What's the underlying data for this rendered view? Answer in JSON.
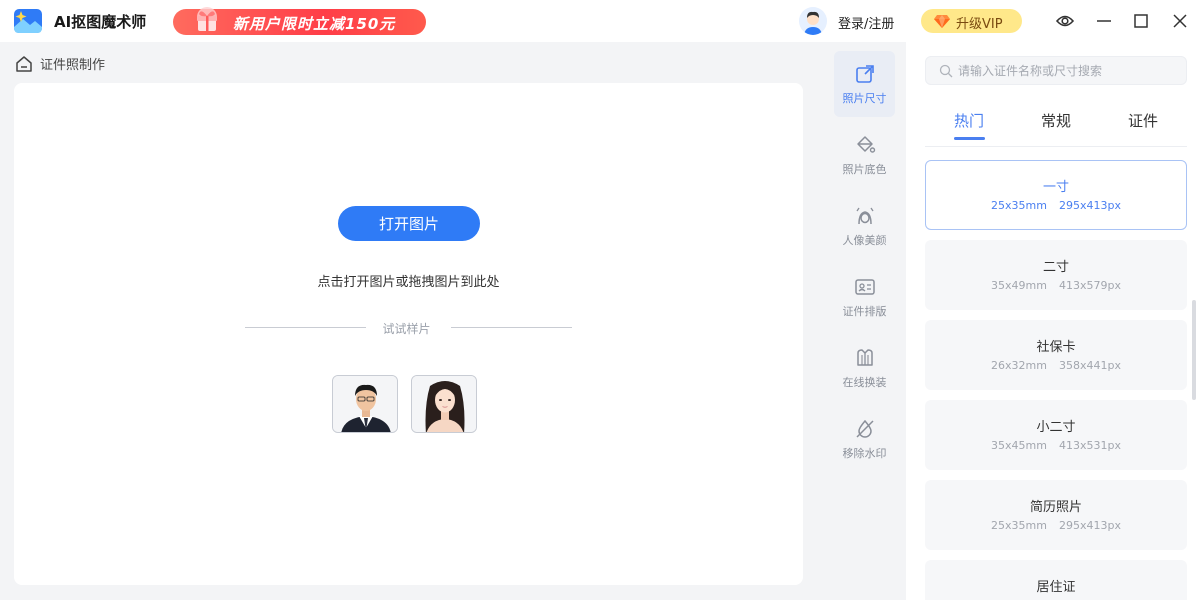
{
  "header": {
    "app_title": "AI抠图魔术师",
    "promo_text": "新用户限时立减150元",
    "login_label": "登录/注册",
    "vip_label": "升级VIP"
  },
  "breadcrumb": {
    "label": "证件照制作"
  },
  "canvas": {
    "open_button_label": "打开图片",
    "hint_text": "点击打开图片或拖拽图片到此处",
    "sample_label": "试试样片"
  },
  "tools": [
    {
      "label": "照片尺寸",
      "icon": "photo-size-icon"
    },
    {
      "label": "照片底色",
      "icon": "paint-bucket-icon"
    },
    {
      "label": "人像美颜",
      "icon": "portrait-beauty-icon"
    },
    {
      "label": "证件排版",
      "icon": "id-card-icon"
    },
    {
      "label": "在线换装",
      "icon": "suit-icon"
    },
    {
      "label": "移除水印",
      "icon": "remove-watermark-icon"
    }
  ],
  "search": {
    "placeholder": "请输入证件名称或尺寸搜索"
  },
  "tabs": [
    {
      "label": "热门"
    },
    {
      "label": "常规"
    },
    {
      "label": "证件"
    }
  ],
  "sizes": [
    {
      "name": "一寸",
      "mm": "25x35mm",
      "px": "295x413px"
    },
    {
      "name": "二寸",
      "mm": "35x49mm",
      "px": "413x579px"
    },
    {
      "name": "社保卡",
      "mm": "26x32mm",
      "px": "358x441px"
    },
    {
      "name": "小二寸",
      "mm": "35x45mm",
      "px": "413x531px"
    },
    {
      "name": "简历照片",
      "mm": "25x35mm",
      "px": "295x413px"
    },
    {
      "name": "居住证",
      "mm": "",
      "px": ""
    }
  ],
  "colors": {
    "accent": "#4a7ff0",
    "primary_button": "#2f7bf6",
    "promo": "#ff3d48",
    "vip": "#ffe88a"
  }
}
